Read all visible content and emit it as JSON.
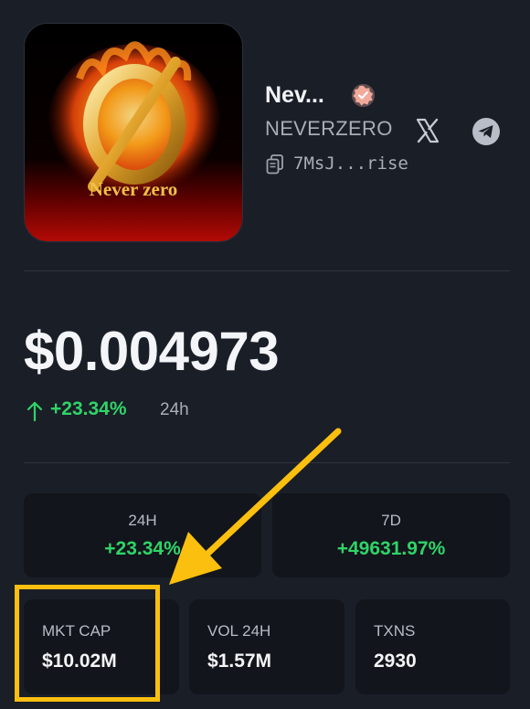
{
  "token": {
    "name": "Nev...",
    "ticker": "NEVERZERO",
    "address": "7MsJ...rise",
    "logo_text": "Never zero"
  },
  "price": {
    "value": "$0.004973",
    "change": "+23.34%",
    "period": "24h"
  },
  "stats_top": [
    {
      "label": "24H",
      "value": "+23.34%"
    },
    {
      "label": "7D",
      "value": "+49631.97%"
    }
  ],
  "stats_bottom": [
    {
      "label": "MKT CAP",
      "value": "$10.02M"
    },
    {
      "label": "VOL 24H",
      "value": "$1.57M"
    },
    {
      "label": "TXNS",
      "value": "2930"
    }
  ],
  "colors": {
    "background": "#1a1e27",
    "card": "#12151b",
    "positive": "#2fd468",
    "highlight": "#fbbf0f"
  },
  "icons": {
    "verified": "verified-badge-icon",
    "x": "x-icon",
    "telegram": "telegram-icon",
    "copy": "copy-icon",
    "up": "arrow-up-icon"
  }
}
